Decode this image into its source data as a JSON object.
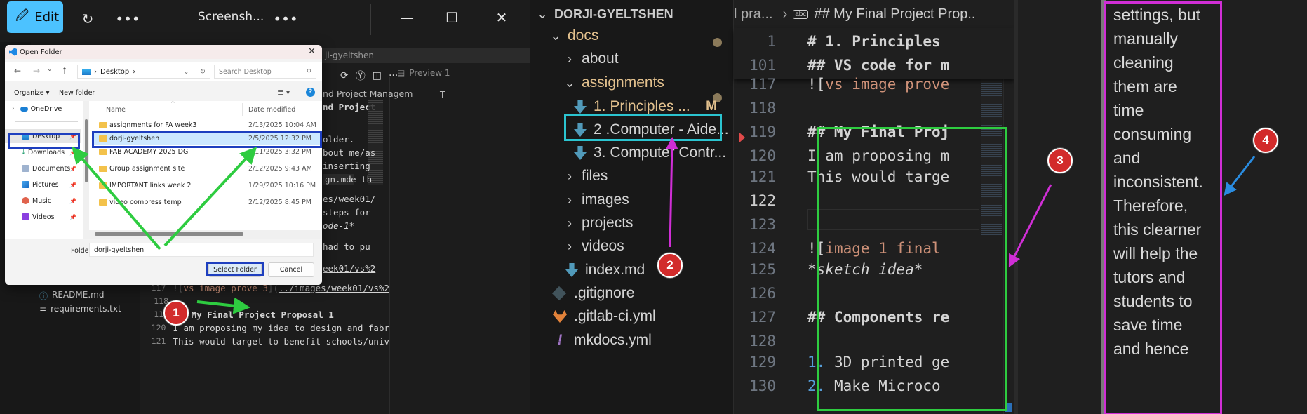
{
  "photos_viewer": {
    "edit_label": "Edit",
    "title": "Screensh...",
    "more_label": "•••"
  },
  "left_vscode": {
    "tab_title": "ji-gyeltshen",
    "preview_tab": "Preview 1",
    "preview_letter": "T",
    "heading_fragment": "nd Project Managem",
    "heading_fragment2": "nd Project",
    "code_fragments": [
      "older.",
      "bout me/as",
      "inserting",
      "gn.md",
      "e th",
      "es/week01/",
      "steps for",
      "ode-1*",
      "had to pu",
      "eek01/vs%2"
    ],
    "explorer_files": [
      "README.md",
      "requirements.txt"
    ],
    "code_lines": [
      {
        "num": "117",
        "text": "![vs image prove 3](../images/week01/vs%2"
      },
      {
        "num": "118",
        "text": ""
      },
      {
        "num": "119",
        "text": "## My Final Project Proposal 1"
      },
      {
        "num": "120",
        "text": "I am proposing my idea to design and fabr"
      },
      {
        "num": "121",
        "text": "This would target to benefit schools/univ"
      }
    ]
  },
  "dialog": {
    "title": "Open Folder",
    "address_path": "Desktop",
    "search_placeholder": "Search Desktop",
    "organize_label": "Organize ▾",
    "new_folder_label": "New folder",
    "nav_items": [
      {
        "label": "OneDrive",
        "pinned": false
      },
      {
        "label": "Desktop",
        "pinned": true
      },
      {
        "label": "Downloads",
        "pinned": true
      },
      {
        "label": "Documents",
        "pinned": true
      },
      {
        "label": "Pictures",
        "pinned": true
      },
      {
        "label": "Music",
        "pinned": true
      },
      {
        "label": "Videos",
        "pinned": true
      }
    ],
    "columns": {
      "name": "Name",
      "date": "Date modified"
    },
    "files": [
      {
        "name": "assignments for FA week3",
        "date": "2/13/2025 10:04 AM"
      },
      {
        "name": "dorji-gyeltshen",
        "date": "2/5/2025 12:32 PM",
        "selected": true
      },
      {
        "name": "FAB ACADEMY 2025 DG",
        "date": "2/11/2025 3:32 PM"
      },
      {
        "name": "Group assignment site",
        "date": "2/12/2025 9:43 AM"
      },
      {
        "name": "IMPORTANT links week 2",
        "date": "1/29/2025 10:16 PM"
      },
      {
        "name": "video compress temp",
        "date": "2/12/2025 8:45 PM"
      }
    ],
    "folder_label": "Folder:",
    "folder_value": "dorji-gyeltshen",
    "select_button": "Select Folder",
    "cancel_button": "Cancel"
  },
  "explorer": {
    "root": "DORJI-GYELTSHEN",
    "items": [
      {
        "label": "docs",
        "type": "folder-open",
        "modified": true
      },
      {
        "label": "about",
        "type": "folder-closed"
      },
      {
        "label": "assignments",
        "type": "folder-open",
        "modified": true
      },
      {
        "label": "1. Principles ...",
        "type": "md",
        "badge": "M"
      },
      {
        "label": "2 .Computer - Aide...",
        "type": "md"
      },
      {
        "label": "3. Computer Contr...",
        "type": "md"
      },
      {
        "label": "files",
        "type": "folder-closed"
      },
      {
        "label": "images",
        "type": "folder-closed"
      },
      {
        "label": "projects",
        "type": "folder-closed"
      },
      {
        "label": "videos",
        "type": "folder-closed"
      },
      {
        "label": "index.md",
        "type": "md"
      },
      {
        "label": ".gitignore",
        "type": "git"
      },
      {
        "label": ".gitlab-ci.yml",
        "type": "gitlab"
      },
      {
        "label": "mkdocs.yml",
        "type": "yaml"
      }
    ]
  },
  "editor": {
    "breadcrumb_prefix": "l pra...",
    "breadcrumb_symbol": "abc",
    "breadcrumb_current": "## My Final Project Prop..",
    "sticky_lines": [
      {
        "num": "1",
        "text": "# 1. Principles"
      },
      {
        "num": "101",
        "text": "## VS code for m"
      }
    ],
    "lines": [
      {
        "num": "117",
        "text": "![vs image prove"
      },
      {
        "num": "118",
        "text": ""
      },
      {
        "num": "119",
        "text": "## My Final Proj"
      },
      {
        "num": "120",
        "text": "I am proposing m"
      },
      {
        "num": "121",
        "text": "This would targe"
      },
      {
        "num": "122",
        "text": ""
      },
      {
        "num": "123",
        "text": ""
      },
      {
        "num": "124",
        "text": "![image 1 final"
      },
      {
        "num": "125",
        "text": "*sketch idea*"
      },
      {
        "num": "126",
        "text": ""
      },
      {
        "num": "127",
        "text": "## Components re"
      },
      {
        "num": "128",
        "text": ""
      },
      {
        "num": "129",
        "text": "1. 3D printed ge"
      },
      {
        "num": "130",
        "text": "2. Make Microco"
      }
    ],
    "active_line": "122"
  },
  "preview_text": {
    "lines": [
      "settings, but",
      "manually",
      "cleaning",
      "them are",
      "time",
      "consuming",
      "and",
      "inconsistent.",
      "Therefore,",
      "this clearner",
      "will help the",
      "tutors and",
      "students to",
      "save time",
      "and hence"
    ]
  },
  "annotations": {
    "badges": [
      "1",
      "2",
      "3",
      "4"
    ],
    "colors": {
      "green": "#2ecc40",
      "blue": "#1e3fbf",
      "cyan": "#2bc4d0",
      "magenta": "#d02ed6",
      "arrow_blue": "#2a8ce0",
      "badge_red": "#d22b2b"
    }
  }
}
